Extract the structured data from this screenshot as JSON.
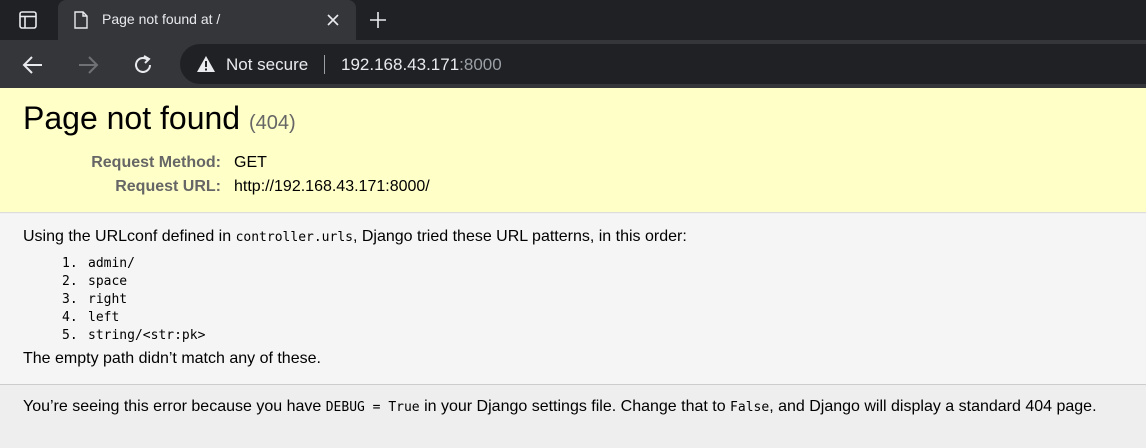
{
  "browser": {
    "tab": {
      "title": "Page not found at /"
    },
    "omnibox": {
      "security_label": "Not secure",
      "url_host": "192.168.43.171",
      "url_port": ":8000"
    }
  },
  "error_page": {
    "title": "Page not found",
    "status": "(404)",
    "request": {
      "method_label": "Request Method:",
      "method_value": "GET",
      "url_label": "Request URL:",
      "url_value": "http://192.168.43.171:8000/"
    },
    "intro": {
      "before": "Using the URLconf defined in ",
      "urlconf": "controller.urls",
      "after": ", Django tried these URL patterns, in this order:"
    },
    "patterns": [
      {
        "num": "1.",
        "pattern": "admin/"
      },
      {
        "num": "2.",
        "pattern": "space"
      },
      {
        "num": "3.",
        "pattern": "right"
      },
      {
        "num": "4.",
        "pattern": "left"
      },
      {
        "num": "5.",
        "pattern": "string/<str:pk>"
      }
    ],
    "no_match": "The empty path didn’t match any of these.",
    "explanation": {
      "part1": "You’re seeing this error because you have ",
      "code1": "DEBUG = True",
      "part2": " in your Django settings file. Change that to ",
      "code2": "False",
      "part3": ", and Django will display a standard 404 page."
    }
  }
}
